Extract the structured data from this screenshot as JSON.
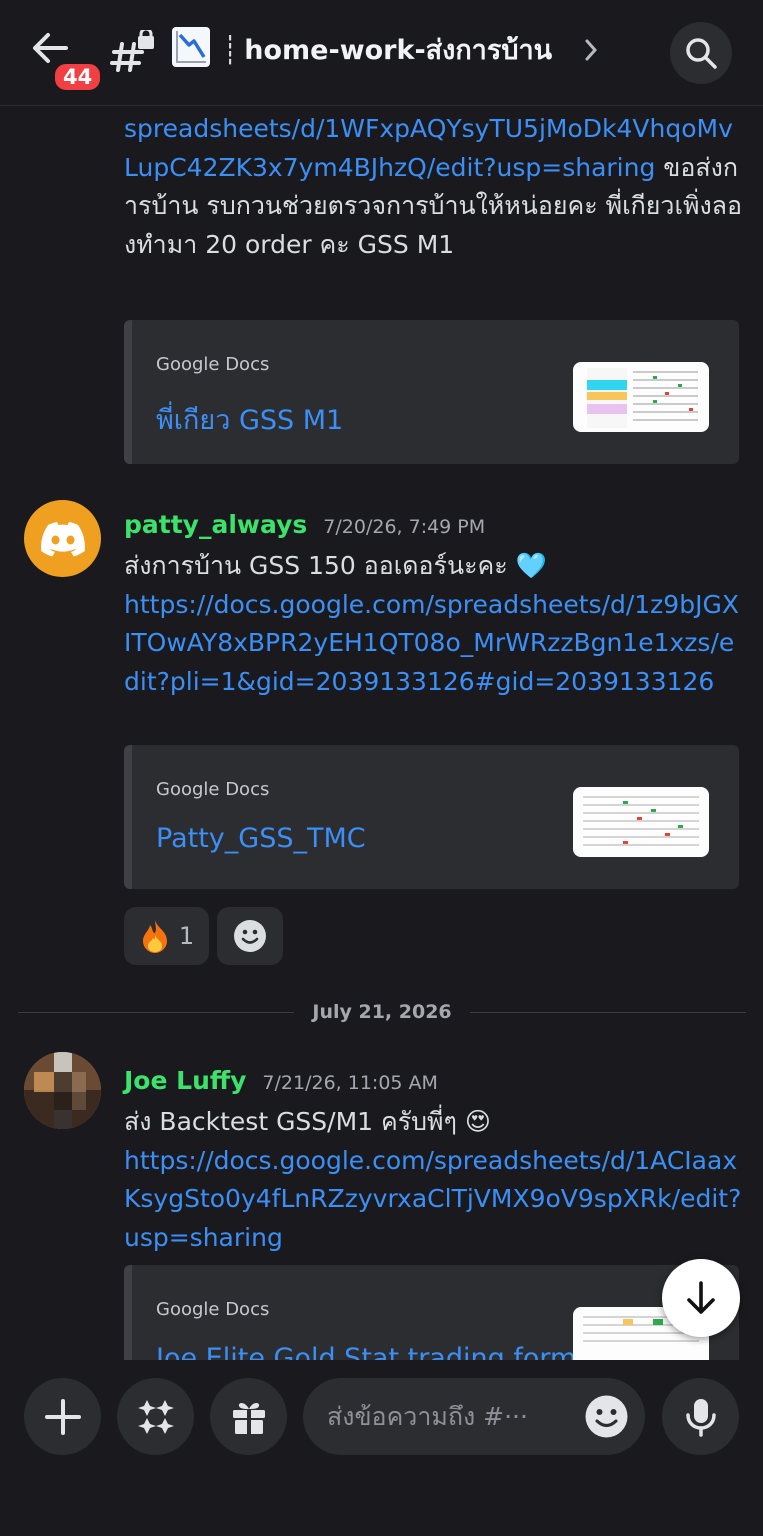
{
  "header": {
    "notification_count": "44",
    "channel_separator": "┊",
    "channel_name": "home-work-ส่งการบ้าน"
  },
  "messages": [
    {
      "continued": true,
      "link": "spreadsheets/d/1WFxpAQYsyTU5jMoDk4VhqoMvLupC42ZK3x7ym4BJhzQ/edit?usp=sharing",
      "text_after_link": " ขอส่งการบ้าน รบกวนช่วยตรวจการบ้านให้หน่อยคะ พี่เกียวเพิ่งลองทำมา 20 order คะ GSS M1",
      "embed": {
        "provider": "Google Docs",
        "title": "พี่เกียว  GSS M1"
      }
    },
    {
      "author": "patty_always",
      "timestamp": "7/20/26, 7:49 PM",
      "text": "ส่งการบ้าน GSS 150 ออเดอร์นะคะ 🩵",
      "link": "https://docs.google.com/spreadsheets/d/1z9bJGXITOwAY8xBPR2yEH1QT08o_MrWRzzBgn1e1xzs/edit?pli=1&gid=2039133126#gid=2039133126",
      "embed": {
        "provider": "Google Docs",
        "title": "Patty_GSS_TMC"
      },
      "reactions": [
        {
          "emoji": "🔥",
          "count": "1"
        }
      ]
    },
    {
      "author": "Joe Luffy",
      "timestamp": "7/21/26, 11:05 AM",
      "text": "ส่ง Backtest GSS/M1 ครับพี่ๆ 😍",
      "link": "https://docs.google.com/spreadsheets/d/1ACIaaxKsygSto0y4fLnRZzyvrxaClTjVMX9oV9spXRk/edit?usp=sharing",
      "embed": {
        "provider": "Google Docs",
        "title": "Joe Elite Gold Stat trading form"
      }
    }
  ],
  "date_divider": "July 21, 2026",
  "composer": {
    "placeholder": "ส่งข้อความถึง #···"
  },
  "colors": {
    "background": "#1a1a1e",
    "link": "#3c8ff5",
    "username": "#3ce26b",
    "badge": "#f23f43",
    "discord_avatar": "#f0a020"
  }
}
